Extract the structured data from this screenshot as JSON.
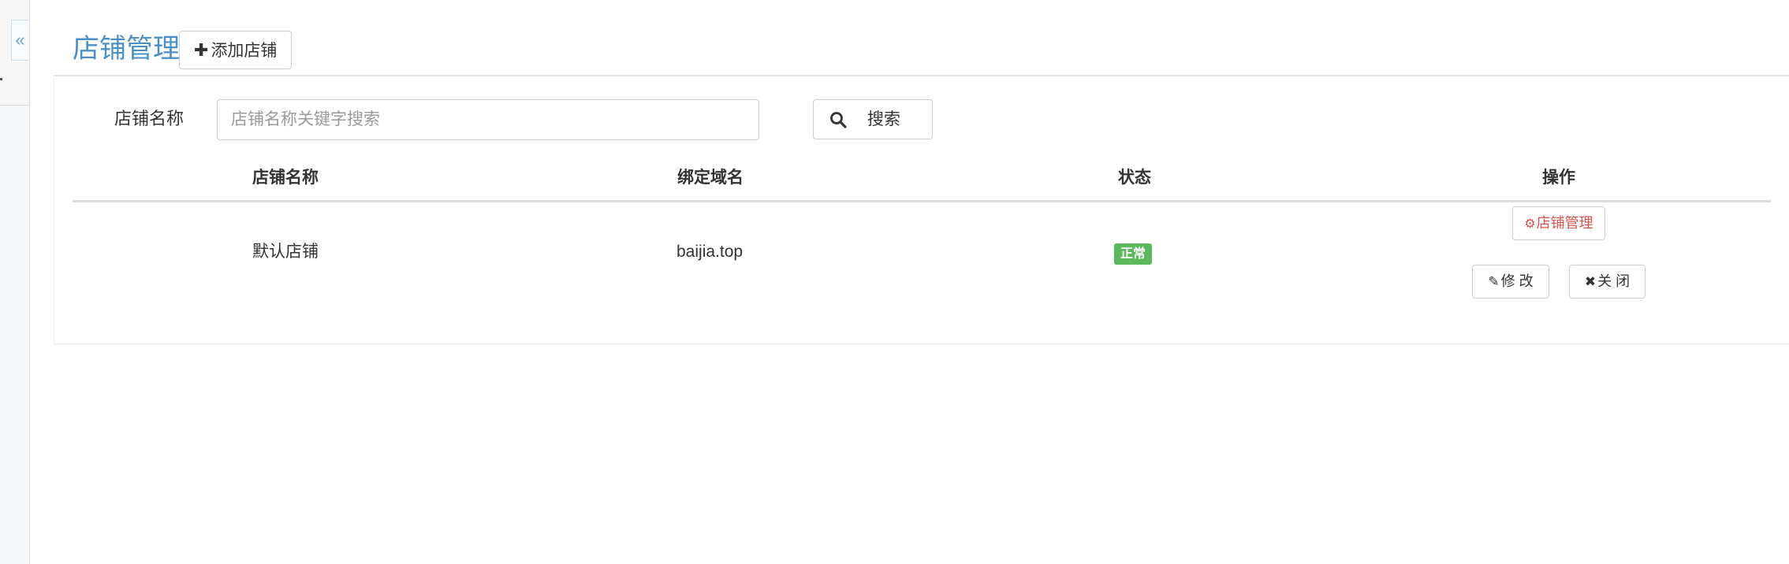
{
  "sidebar": {
    "collapse_label": "«"
  },
  "header": {
    "title": "店铺管理",
    "add_button": {
      "icon": "plus-icon",
      "glyph": "✚",
      "label": "添加店铺"
    }
  },
  "search": {
    "label": "店铺名称",
    "placeholder": "店铺名称关键字搜索",
    "value": "",
    "button_label": "搜索",
    "button_icon": "search-icon"
  },
  "table": {
    "columns": [
      "店铺名称",
      "绑定域名",
      "状态",
      "操作"
    ],
    "rows": [
      {
        "name": "默认店铺",
        "domain": "baijia.top",
        "status": "正常",
        "status_color": "#5cb85c",
        "actions": {
          "manage": {
            "icon": "gear-icon",
            "glyph": "⚙",
            "label": "店铺管理"
          },
          "edit": {
            "icon": "pencil-icon",
            "glyph": "✎",
            "label": "修 改"
          },
          "close": {
            "icon": "close-icon",
            "glyph": "✖",
            "label": "关 闭"
          }
        }
      }
    ]
  },
  "colors": {
    "title": "#4a90c6",
    "manage_text": "#d9534f",
    "status_badge": "#5cb85c"
  }
}
